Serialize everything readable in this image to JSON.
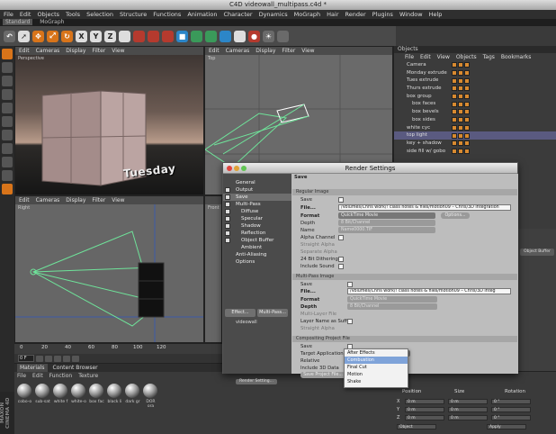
{
  "window": {
    "title": "C4D videowall_multipass.c4d *"
  },
  "menu": [
    "File",
    "Edit",
    "Objects",
    "Tools",
    "Selection",
    "Structure",
    "Functions",
    "Animation",
    "Character",
    "Dynamics",
    "MoGraph",
    "Hair",
    "Render",
    "Plugins",
    "Window",
    "Help"
  ],
  "layout": {
    "items": [
      "Standard",
      "MoGraph"
    ]
  },
  "toolbar": {
    "buttons": [
      "undo-icon",
      "pointer-icon",
      "move-icon",
      "scale-icon",
      "rotate-icon",
      "x-axis-icon",
      "y-axis-icon",
      "z-axis-icon",
      "world-icon",
      "render-icon",
      "render-view-icon",
      "render-settings-icon",
      "cube-icon",
      "nurbs-icon",
      "array-icon",
      "deformer-icon",
      "scene-icon",
      "camera-icon",
      "light-icon",
      "grid-icon"
    ]
  },
  "viewports": {
    "perspective": {
      "menu": [
        "Edit",
        "Cameras",
        "Display",
        "Filter",
        "View"
      ],
      "label": "Perspective",
      "text3d": "Tuesday"
    },
    "top": {
      "menu": [
        "Edit",
        "Cameras",
        "Display",
        "Filter",
        "View"
      ],
      "label": "Top"
    },
    "right": {
      "menu": [
        "Edit",
        "Cameras",
        "Display",
        "Filter",
        "View"
      ],
      "label": "Right"
    },
    "front": {
      "label": "Front"
    }
  },
  "timeline": {
    "ticks": [
      "0",
      "20",
      "40",
      "60",
      "80",
      "100",
      "120"
    ],
    "frame": "0 F"
  },
  "materials": {
    "tabs": [
      "Materials",
      "Content Browser"
    ],
    "menu": [
      "File",
      "Edit",
      "Function",
      "Texture"
    ],
    "items": [
      "cobo-o",
      "sub-sat",
      "white f",
      "white-o",
      "box fac",
      "black li",
      "dark gr",
      "DOR ora"
    ]
  },
  "objects": {
    "header": "Objects",
    "menu": [
      "File",
      "Edit",
      "View",
      "Objects",
      "Tags",
      "Bookmarks"
    ],
    "rows": [
      {
        "name": "Camera",
        "sel": false,
        "indent": 0
      },
      {
        "name": "Monday extrude",
        "sel": false,
        "indent": 0
      },
      {
        "name": "Tues extrude",
        "sel": false,
        "indent": 0
      },
      {
        "name": "Thurs extrude",
        "sel": false,
        "indent": 0
      },
      {
        "name": "box group",
        "sel": false,
        "indent": 0
      },
      {
        "name": "box faces",
        "sel": false,
        "indent": 1
      },
      {
        "name": "box bevels",
        "sel": false,
        "indent": 1
      },
      {
        "name": "box sides",
        "sel": false,
        "indent": 1
      },
      {
        "name": "white cyc",
        "sel": false,
        "indent": 0
      },
      {
        "name": "top light",
        "sel": true,
        "indent": 0
      },
      {
        "name": "key + shadow",
        "sel": false,
        "indent": 0
      },
      {
        "name": "side fill w/ gobo",
        "sel": false,
        "indent": 0
      }
    ]
  },
  "attributes": {
    "button": "Object Buffer"
  },
  "coordinates": {
    "headers": [
      "Position",
      "Size",
      "Rotation"
    ],
    "rows": [
      {
        "axis": "X",
        "pos": "0 m",
        "size": "0 m",
        "rot": "0 °"
      },
      {
        "axis": "Y",
        "pos": "0 m",
        "size": "0 m",
        "rot": "0 °"
      },
      {
        "axis": "Z",
        "pos": "0 m",
        "size": "0 m",
        "rot": "0 °"
      }
    ],
    "mode": "Object",
    "apply": "Apply"
  },
  "dialog": {
    "title": "Render Settings",
    "sidebar": [
      {
        "label": "General",
        "check": false,
        "indent": 0,
        "sel": false
      },
      {
        "label": "Output",
        "check": true,
        "indent": 0,
        "sel": false
      },
      {
        "label": "Save",
        "check": true,
        "indent": 0,
        "sel": true
      },
      {
        "label": "Multi-Pass",
        "check": true,
        "indent": 0,
        "sel": false
      },
      {
        "label": "Diffuse",
        "check": true,
        "indent": 1,
        "sel": false
      },
      {
        "label": "Specular",
        "check": true,
        "indent": 1,
        "sel": false
      },
      {
        "label": "Shadow",
        "check": true,
        "indent": 1,
        "sel": false
      },
      {
        "label": "Reflection",
        "check": true,
        "indent": 1,
        "sel": false
      },
      {
        "label": "Object Buffer",
        "check": true,
        "indent": 1,
        "sel": false
      },
      {
        "label": "Ambient",
        "check": false,
        "indent": 1,
        "sel": false
      },
      {
        "label": "Anti-Aliasing",
        "check": false,
        "indent": 0,
        "sel": false
      },
      {
        "label": "Options",
        "check": false,
        "indent": 0,
        "sel": false
      }
    ],
    "effect_btn": "Effect...",
    "multipass_btn": "Multi-Pass...",
    "preset": "videowall",
    "render_btn": "Render Setting...",
    "panel_title": "Save",
    "regular": {
      "header": "Regular Image",
      "save": "Save",
      "file": "File...",
      "path": "/Volumes/Chris work/! class notes & files/motion09 – Chris/3D integration",
      "format": "Format",
      "format_val": "QuickTime Movie",
      "options": "Options...",
      "depth": "Depth",
      "depth_val": "8 Bit/Channel",
      "name": "Name",
      "name_val": "Name0000.TIF",
      "alpha": "Alpha Channel",
      "straight": "Straight Alpha",
      "separate": "Separate Alpha",
      "dither": "24 Bit Dithering",
      "sound": "Include Sound"
    },
    "multi": {
      "header": "Multi-Pass Image",
      "save": "Save",
      "file": "File...",
      "path": "/Volumes/Chris work/! class notes & files/motion09 – Chris/3D integ",
      "format": "Format",
      "format_val": "QuickTime Movie",
      "depth": "Depth",
      "depth_val": "8 Bit/Channel",
      "mlf": "Multi-Layer File",
      "suffix": "Layer Name as Suffix",
      "straight": "Straight Alpha"
    },
    "comp": {
      "header": "Compositing Project File",
      "save": "Save",
      "target": "Target Application",
      "target_val": "After Effects",
      "relative": "Relative",
      "include3d": "Include 3D Data",
      "save_btn": "Save Project File..."
    },
    "dropdown": [
      {
        "label": "After Effects",
        "hl": false
      },
      {
        "label": "Combustion",
        "hl": true
      },
      {
        "label": "Final Cut",
        "hl": false
      },
      {
        "label": "Motion",
        "hl": false
      },
      {
        "label": "Shake",
        "hl": false
      }
    ]
  }
}
